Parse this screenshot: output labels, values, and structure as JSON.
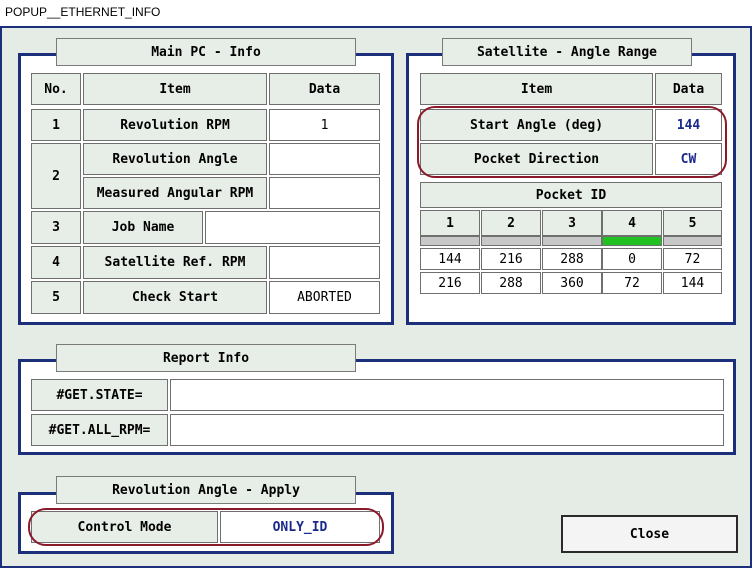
{
  "window": {
    "title": "POPUP__ETHERNET_INFO"
  },
  "main_pc": {
    "title": "Main PC - Info",
    "headers": {
      "no": "No.",
      "item": "Item",
      "data": "Data"
    },
    "rows": [
      {
        "no": "1",
        "item": "Revolution RPM",
        "data": "1"
      },
      {
        "no": "2",
        "item": "Revolution Angle",
        "data": ""
      },
      {
        "item": "Measured Angular RPM",
        "data": ""
      },
      {
        "no": "3",
        "item": "Job Name",
        "data": ""
      },
      {
        "no": "4",
        "item": "Satellite Ref. RPM",
        "data": ""
      },
      {
        "no": "5",
        "item": "Check Start",
        "data": "ABORTED"
      }
    ]
  },
  "satellite": {
    "title": "Satellite - Angle Range",
    "headers": {
      "item": "Item",
      "data": "Data"
    },
    "start_angle_label": "Start Angle (deg)",
    "start_angle_value": "144",
    "pocket_direction_label": "Pocket Direction",
    "pocket_direction_value": "CW",
    "pocket_id_label": "Pocket ID",
    "pocket_ids": [
      "1",
      "2",
      "3",
      "4",
      "5"
    ],
    "active_pocket": "4",
    "active_color": "#22c122",
    "row1": [
      "144",
      "216",
      "288",
      "0",
      "72"
    ],
    "row2": [
      "216",
      "288",
      "360",
      "72",
      "144"
    ]
  },
  "report": {
    "title": "Report Info",
    "get_state_label": "#GET.STATE=",
    "get_state_value": "",
    "get_all_rpm_label": "#GET.ALL_RPM=",
    "get_all_rpm_value": ""
  },
  "apply": {
    "title": "Revolution Angle - Apply",
    "control_mode_label": "Control Mode",
    "control_mode_value": "ONLY_ID"
  },
  "close_label": "Close",
  "colors": {
    "frame": "#1b2f7a",
    "highlight": "#8a1a2a",
    "value_text": "#1a2a8c",
    "background": "#e5ebe5"
  }
}
